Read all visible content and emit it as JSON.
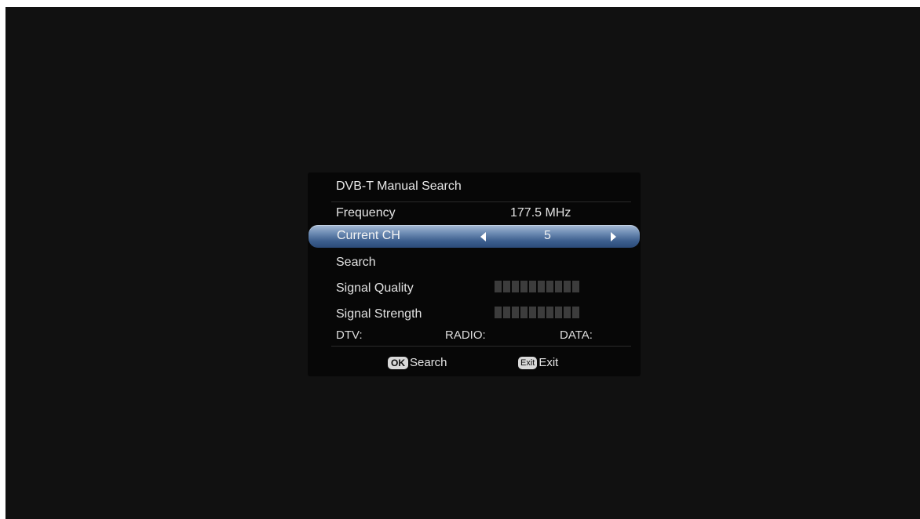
{
  "menu": {
    "title": "DVB-T Manual Search",
    "frequency_label": "Frequency",
    "frequency_value": "177.5 MHz",
    "current_ch_label": "Current CH",
    "current_ch_value": "5",
    "search_label": "Search",
    "signal_quality_label": "Signal Quality",
    "signal_quality_level": 0,
    "signal_strength_label": "Signal Strength",
    "signal_strength_level": 0,
    "dtv_label": "DTV:",
    "radio_label": "RADIO:",
    "data_label": "DATA:"
  },
  "hints": {
    "ok_key": "OK",
    "ok_label": "Search",
    "exit_key": "Exit",
    "exit_label": "Exit"
  },
  "colors": {
    "background": "#111111",
    "panel": "#070707",
    "highlight": "#4a6a98"
  }
}
